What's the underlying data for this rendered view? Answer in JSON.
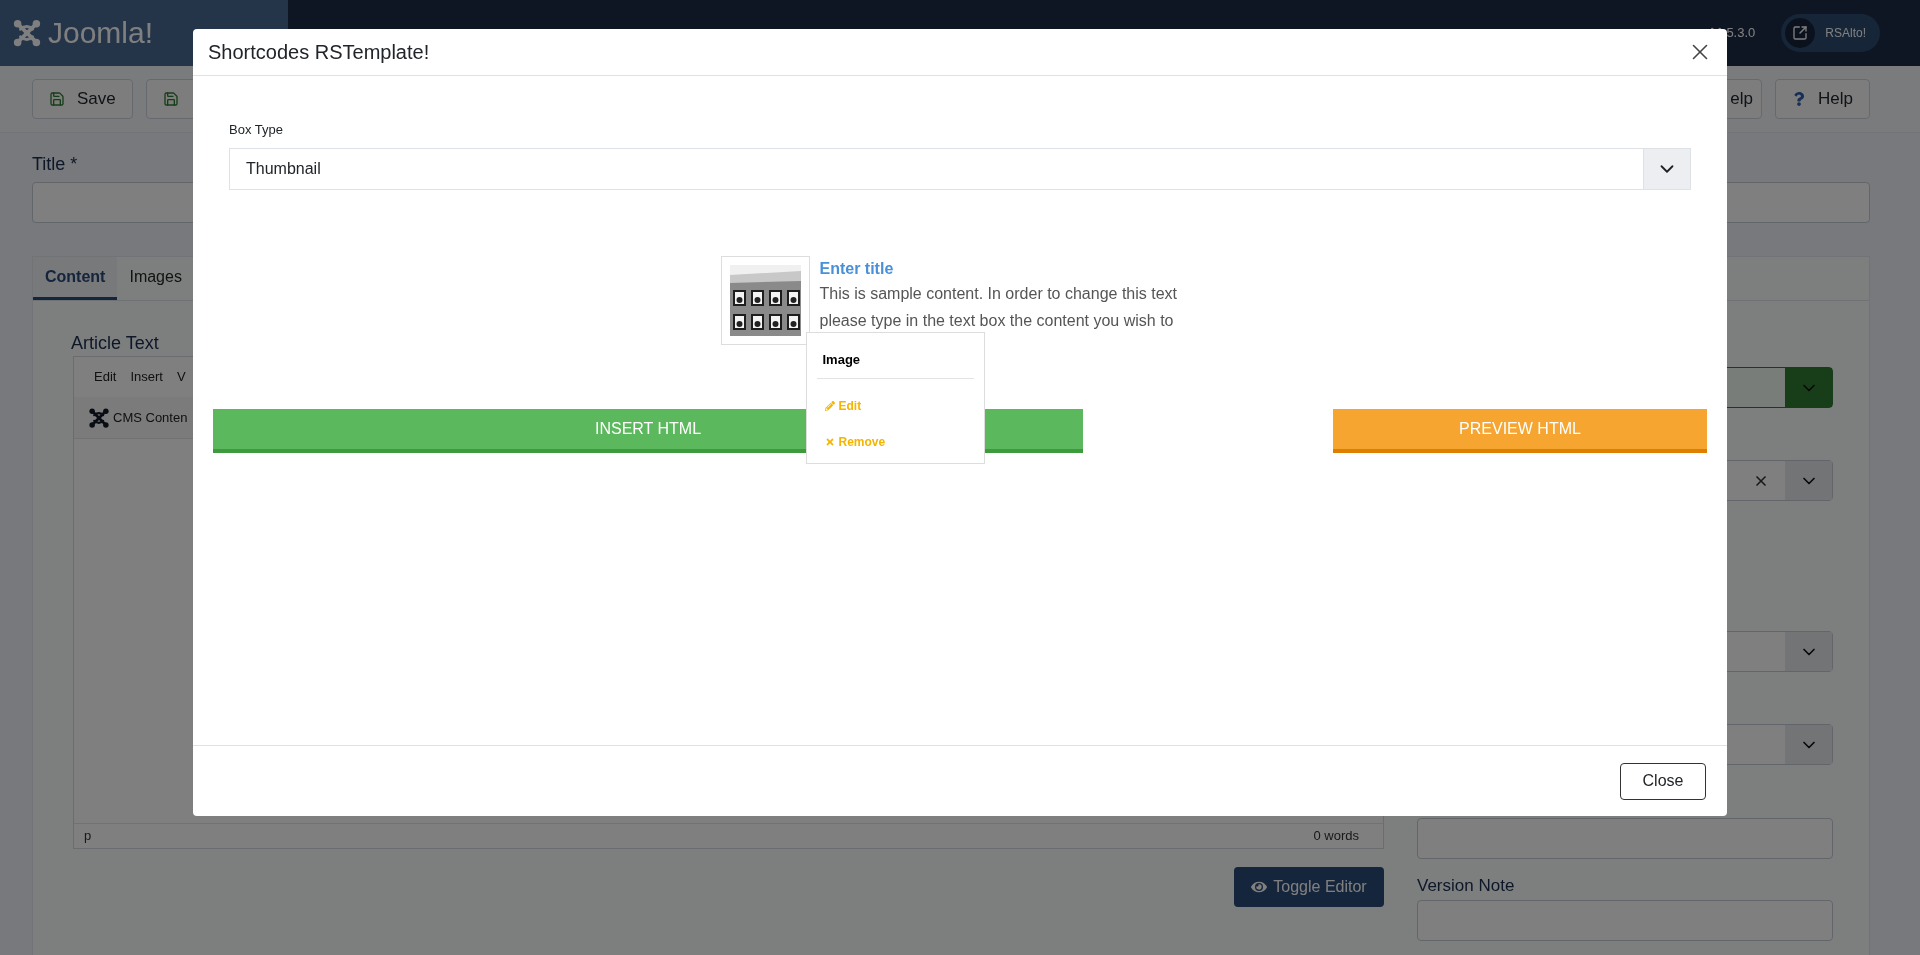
{
  "header": {
    "logo": "Joomla!",
    "version": "5.3.0",
    "site_button": "RSAlto!"
  },
  "toolbar": [
    {
      "kind": "save",
      "label": "Save"
    },
    {
      "kind": "save"
    },
    {
      "kind": "plain",
      "label": "elp"
    },
    {
      "kind": "help",
      "label": "Help"
    }
  ],
  "title_field": {
    "label": "Title *"
  },
  "tabs": [
    {
      "label": "Content",
      "selected": true
    },
    {
      "label": "Images",
      "selected": false
    }
  ],
  "editor": {
    "label": "Article Text",
    "menu": [
      "Edit",
      "Insert",
      "V"
    ],
    "toolbar_button": "CMS Conten",
    "path": "p",
    "word_count": "0 words"
  },
  "toggle_button": "Toggle Editor",
  "side_fields": [
    {
      "kind": "select",
      "highlighted": true,
      "clearable": false
    },
    {
      "kind": "select",
      "highlighted": false,
      "clearable": true
    },
    {
      "kind": "select",
      "highlighted": false,
      "clearable": false
    },
    {
      "kind": "select",
      "highlighted": false,
      "clearable": false
    },
    {
      "kind": "input"
    },
    {
      "kind": "input",
      "label": "Version Note"
    }
  ],
  "modal": {
    "title": "Shortcodes RSTemplate!",
    "box_type": {
      "label": "Box Type",
      "value": "Thumbnail"
    },
    "preview": {
      "title": "Enter title",
      "lines": [
        "This is sample content. In order to change this text",
        "please type in the text box the content you wish to"
      ]
    },
    "popover": {
      "title": "Image",
      "actions": [
        {
          "kind": "edit",
          "label": "Edit"
        },
        {
          "kind": "remove",
          "label": "Remove"
        }
      ]
    },
    "actions": [
      {
        "kind": "insert",
        "label": "INSERT HTML"
      },
      {
        "kind": "preview",
        "label": "PREVIEW HTML"
      }
    ],
    "close_button": "Close"
  }
}
